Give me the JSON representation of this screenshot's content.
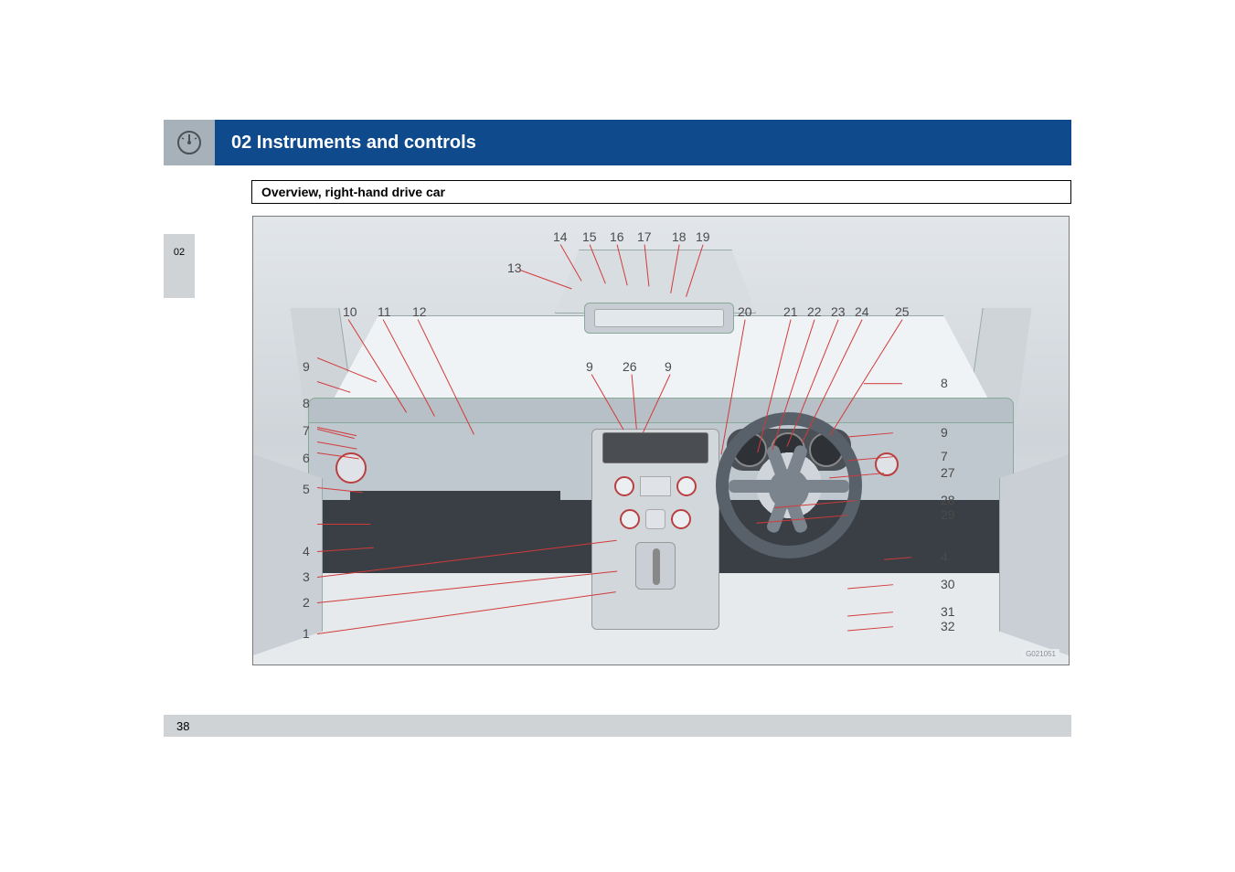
{
  "header": {
    "chapter_title": "02 Instruments and controls"
  },
  "section_title": "Overview, right-hand drive car",
  "side_tab": "02",
  "page_number": "38",
  "image_watermark": "G021051",
  "callouts": {
    "left": [
      "1",
      "2",
      "3",
      "4",
      "5",
      "6",
      "7",
      "8",
      "9",
      "10",
      "11",
      "12",
      "13"
    ],
    "top": [
      "14",
      "15",
      "16",
      "17",
      "18",
      "19"
    ],
    "mid": [
      "9",
      "26",
      "9"
    ],
    "top_right": [
      "20",
      "21",
      "22",
      "23",
      "24",
      "25"
    ],
    "right": [
      "8",
      "9",
      "7",
      "27",
      "28",
      "29",
      "4",
      "30",
      "31",
      "32"
    ]
  }
}
